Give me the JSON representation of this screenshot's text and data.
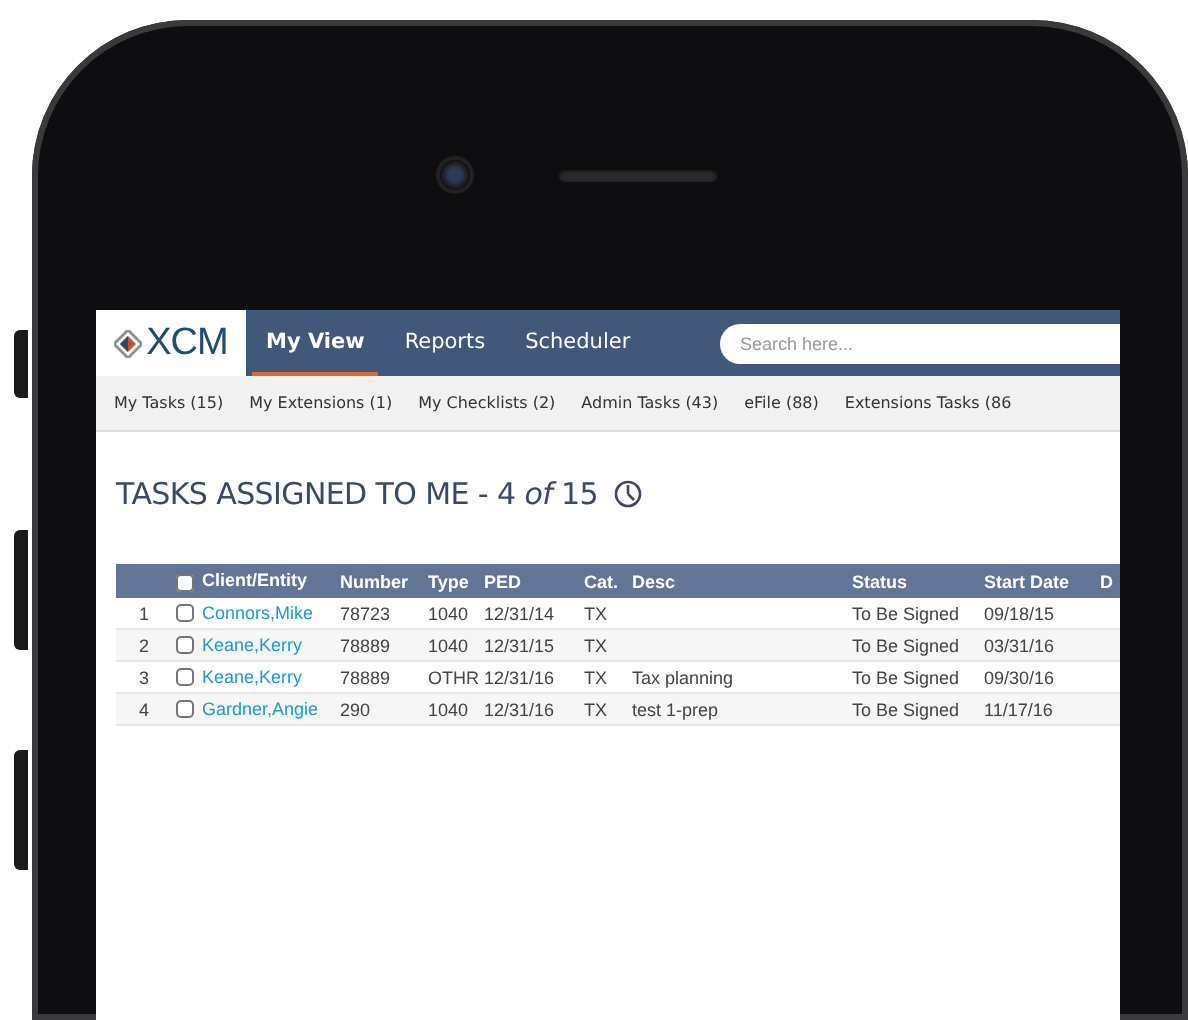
{
  "logo": {
    "text": "XCM"
  },
  "nav": {
    "tabs": [
      {
        "label": "My View",
        "selected": true
      },
      {
        "label": "Reports",
        "selected": false
      },
      {
        "label": "Scheduler",
        "selected": false
      }
    ],
    "search": {
      "placeholder": "Search here..."
    }
  },
  "subnav": {
    "items": [
      "My Tasks (15)",
      "My Extensions (1)",
      "My Checklists (2)",
      "Admin Tasks (43)",
      "eFile (88)",
      "Extensions Tasks (86"
    ]
  },
  "title": "TASKS ASSIGNED TO ME - 4 *of* 15",
  "table": {
    "select_all": {
      "checked": false
    },
    "columns": [
      "Client/Entity",
      "Number",
      "Type",
      "PED",
      "Cat.",
      "Desc",
      "Status",
      "Start Date",
      "D"
    ],
    "rows": [
      {
        "index": "1",
        "checked": false,
        "client": "Connors,Mike",
        "number": "78723",
        "type": "1040",
        "ped": "12/31/14",
        "cat": "TX",
        "desc": "",
        "status": "To Be Signed",
        "start_date": "09/18/15"
      },
      {
        "index": "2",
        "checked": false,
        "client": "Keane,Kerry",
        "number": "78889",
        "type": "1040",
        "ped": "12/31/15",
        "cat": "TX",
        "desc": "",
        "status": "To Be Signed",
        "start_date": "03/31/16"
      },
      {
        "index": "3",
        "checked": false,
        "client": "Keane,Kerry",
        "number": "78889",
        "type": "OTHR",
        "ped": "12/31/16",
        "cat": "TX",
        "desc": "Tax planning",
        "status": "To Be Signed",
        "start_date": "09/30/16"
      },
      {
        "index": "4",
        "checked": false,
        "client": "Gardner,Angie",
        "number": "290",
        "type": "1040",
        "ped": "12/31/16",
        "cat": "TX",
        "desc": "test 1-prep",
        "status": "To Be Signed",
        "start_date": "11/17/16"
      }
    ]
  }
}
